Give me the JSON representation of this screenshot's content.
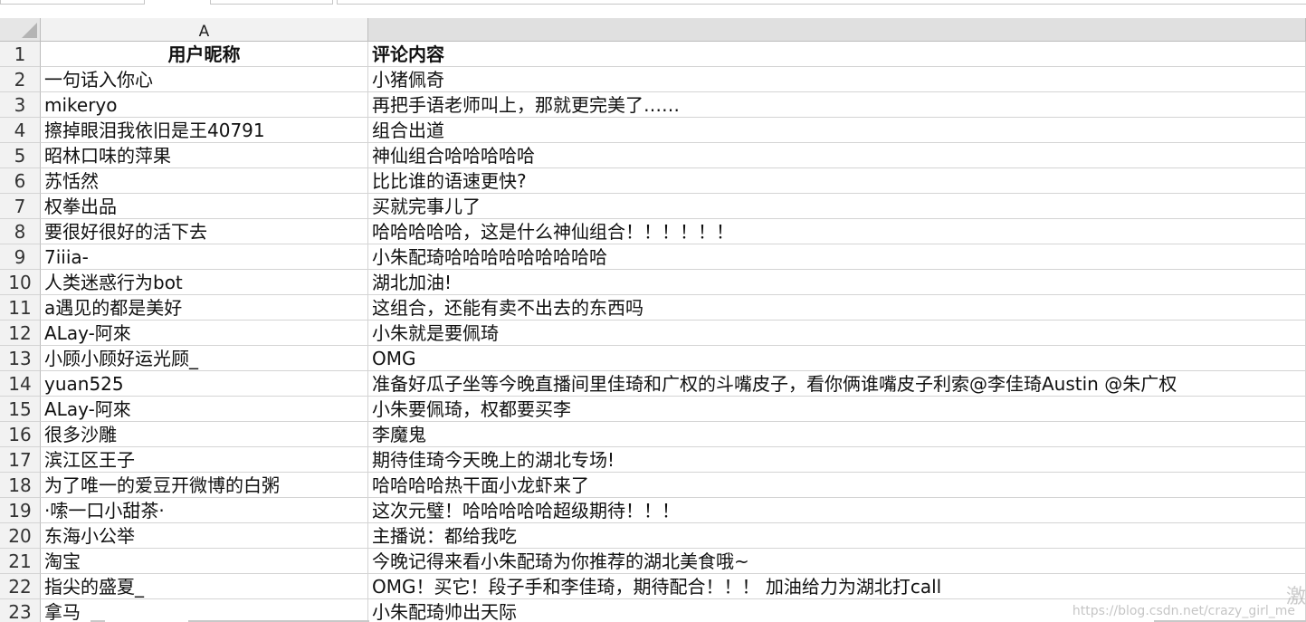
{
  "sheet": {
    "column_headers": [
      "A",
      ""
    ],
    "header_row": {
      "row": "1",
      "col_a": "用户昵称",
      "col_b": "评论内容"
    },
    "rows": [
      {
        "row": "2",
        "col_a": "一句话入你心",
        "col_b": "小猪佩奇"
      },
      {
        "row": "3",
        "col_a": "mikeryo",
        "col_b": "再把手语老师叫上，那就更完美了……"
      },
      {
        "row": "4",
        "col_a": "擦掉眼泪我依旧是王40791",
        "col_b": "组合出道"
      },
      {
        "row": "5",
        "col_a": "昭林口味的萍果",
        "col_b": "神仙组合哈哈哈哈哈"
      },
      {
        "row": "6",
        "col_a": "苏恬然",
        "col_b": "比比谁的语速更快?"
      },
      {
        "row": "7",
        "col_a": "权拳出品",
        "col_b": "买就完事儿了"
      },
      {
        "row": "8",
        "col_a": "要很好很好的活下去",
        "col_b": "哈哈哈哈哈，这是什么神仙组合！！！！！！"
      },
      {
        "row": "9",
        "col_a": "7iiia-",
        "col_b": "小朱配琦哈哈哈哈哈哈哈哈哈"
      },
      {
        "row": "10",
        "col_a": "人类迷惑行为bot",
        "col_b": "湖北加油!"
      },
      {
        "row": "11",
        "col_a": "a遇见的都是美好",
        "col_b": "这组合，还能有卖不出去的东西吗"
      },
      {
        "row": "12",
        "col_a": "ALay-阿來",
        "col_b": "小朱就是要佩琦"
      },
      {
        "row": "13",
        "col_a": "小顾小顾好运光顾_",
        "col_b": "OMG"
      },
      {
        "row": "14",
        "col_a": "yuan525",
        "col_b": "准备好瓜子坐等今晚直播间里佳琦和广权的斗嘴皮子，看你俩谁嘴皮子利索@李佳琦Austin @朱广权"
      },
      {
        "row": "15",
        "col_a": "ALay-阿來",
        "col_b": "小朱要佩琦，权都要买李"
      },
      {
        "row": "16",
        "col_a": "很多沙雕",
        "col_b": "李魔鬼"
      },
      {
        "row": "17",
        "col_a": "滨江区王子",
        "col_b": "期待佳琦今天晚上的湖北专场!"
      },
      {
        "row": "18",
        "col_a": "为了唯一的爱豆开微博的白粥",
        "col_b": "哈哈哈哈热干面小龙虾来了"
      },
      {
        "row": "19",
        "col_a": "·嗦一口小甜茶·",
        "col_b": "这次元璧！哈哈哈哈哈超级期待！！！"
      },
      {
        "row": "20",
        "col_a": "东海小公举",
        "col_b": "主播说：都给我吃"
      },
      {
        "row": "21",
        "col_a": "淘宝",
        "col_b": "今晚记得来看小朱配琦为你推荐的湖北美食哦~"
      },
      {
        "row": "22",
        "col_a": "指尖的盛夏_",
        "col_b": "OMG！买它！段子手和李佳琦，期待配合！！！ 加油给力为湖北打call"
      },
      {
        "row": "23",
        "col_a": "拿马",
        "col_b": "小朱配琦帅出天际"
      }
    ]
  },
  "watermark": {
    "text": "https://blog.csdn.net/crazy_girl_me",
    "glyph": "激"
  },
  "colors": {
    "header_bg": "#f2f2f2",
    "selected_col_bg": "#e0e0e0",
    "gridline": "#d4d4d4"
  }
}
